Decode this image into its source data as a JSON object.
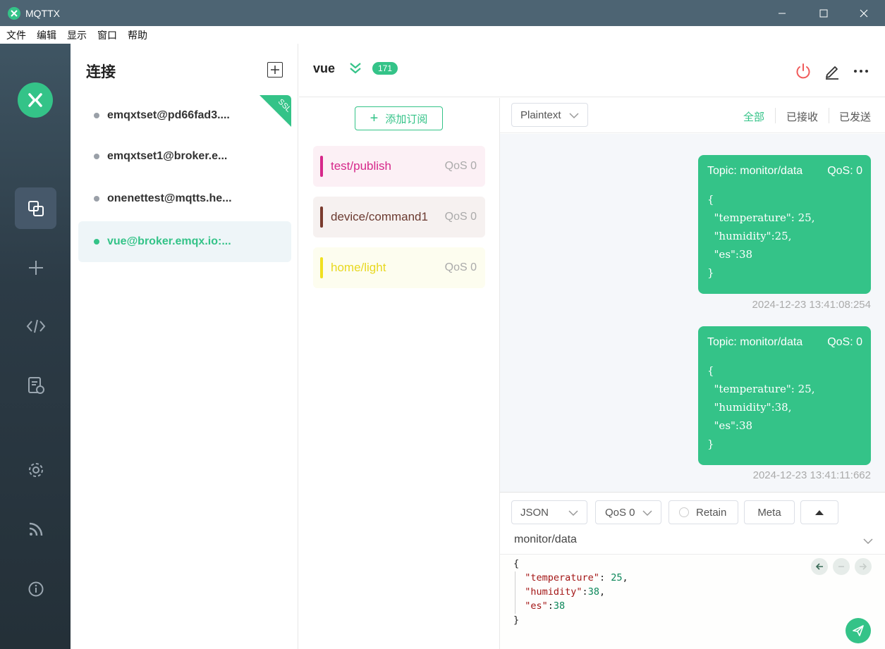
{
  "window": {
    "title": "MQTTX"
  },
  "menu": [
    "文件",
    "编辑",
    "显示",
    "窗口",
    "帮助"
  ],
  "connections": {
    "title": "连接",
    "items": [
      {
        "label": "emqxtset@pd66fad3....",
        "ssl": true,
        "ssl_label": "SSL"
      },
      {
        "label": "emqxtset1@broker.e...",
        "ssl": false
      },
      {
        "label": "onenettest@mqtts.he...",
        "ssl": false
      },
      {
        "label": "vue@broker.emqx.io:...",
        "ssl": false,
        "active": true
      }
    ]
  },
  "header": {
    "name": "vue",
    "count": "171"
  },
  "subscriptions": {
    "add_label": "添加订阅",
    "items": [
      {
        "topic": "test/publish",
        "qos": "QoS 0",
        "color": "#d6288a",
        "bg": "#fcf0f5"
      },
      {
        "topic": "device/command1",
        "qos": "QoS 0",
        "color": "#7a3b2e",
        "bg": "#f6f1f0"
      },
      {
        "topic": "home/light",
        "qos": "QoS 0",
        "color": "#f0e020",
        "bg": "#fdfdef"
      }
    ]
  },
  "messages": {
    "format": "Plaintext",
    "filters": [
      "全部",
      "已接收",
      "已发送"
    ],
    "list": [
      {
        "topic": "Topic: monitor/data",
        "qos": "QoS: 0",
        "payload": "{\n  \"temperature\": 25,\n  \"humidity\":25,\n  \"es\":38\n}",
        "time": "2024-12-23 13:41:08:254"
      },
      {
        "topic": "Topic: monitor/data",
        "qos": "QoS: 0",
        "payload": "{\n  \"temperature\": 25,\n  \"humidity\":38,\n  \"es\":38\n}",
        "time": "2024-12-23 13:41:11:662"
      }
    ]
  },
  "composer": {
    "format": "JSON",
    "qos": "QoS 0",
    "retain": "Retain",
    "meta": "Meta",
    "topic": "monitor/data",
    "payload_lines": [
      "{",
      "  \"temperature\": 25,",
      "  \"humidity\":38,",
      "  \"es\":38",
      "}"
    ]
  },
  "colors": {
    "accent": "#34c388",
    "nav_bg": "#2c3b46",
    "titlebar": "#4d6473"
  }
}
